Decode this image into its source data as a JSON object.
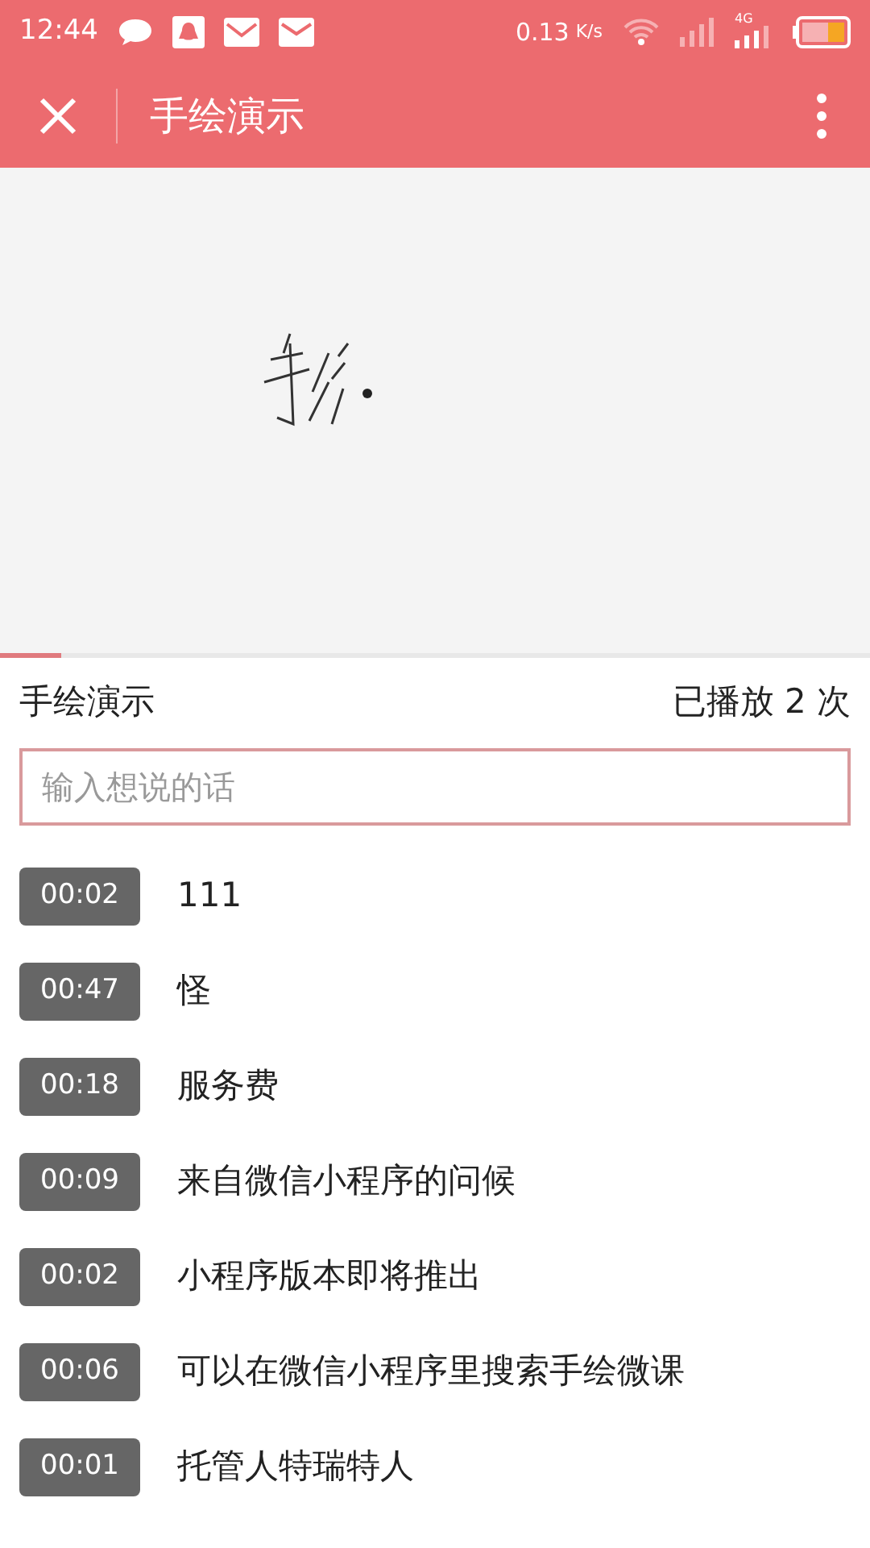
{
  "status_bar": {
    "time": "12:44",
    "speed": "0.13",
    "speed_unit": "K/s",
    "network": "4G"
  },
  "app_bar": {
    "title": "手绘演示"
  },
  "playback": {
    "level": 0.07
  },
  "info": {
    "title": "手绘演示",
    "play_count": "已播放 2 次"
  },
  "comment_input": {
    "placeholder": "输入想说的话"
  },
  "comments": [
    {
      "time": "00:02",
      "text": "111"
    },
    {
      "time": "00:47",
      "text": "怪"
    },
    {
      "time": "00:18",
      "text": "服务费"
    },
    {
      "time": "00:09",
      "text": "来自微信小程序的问候"
    },
    {
      "time": "00:02",
      "text": "小程序版本即将推出"
    },
    {
      "time": "00:06",
      "text": "可以在微信小程序里搜索手绘微课"
    },
    {
      "time": "00:01",
      "text": "托管人特瑞特人"
    }
  ]
}
